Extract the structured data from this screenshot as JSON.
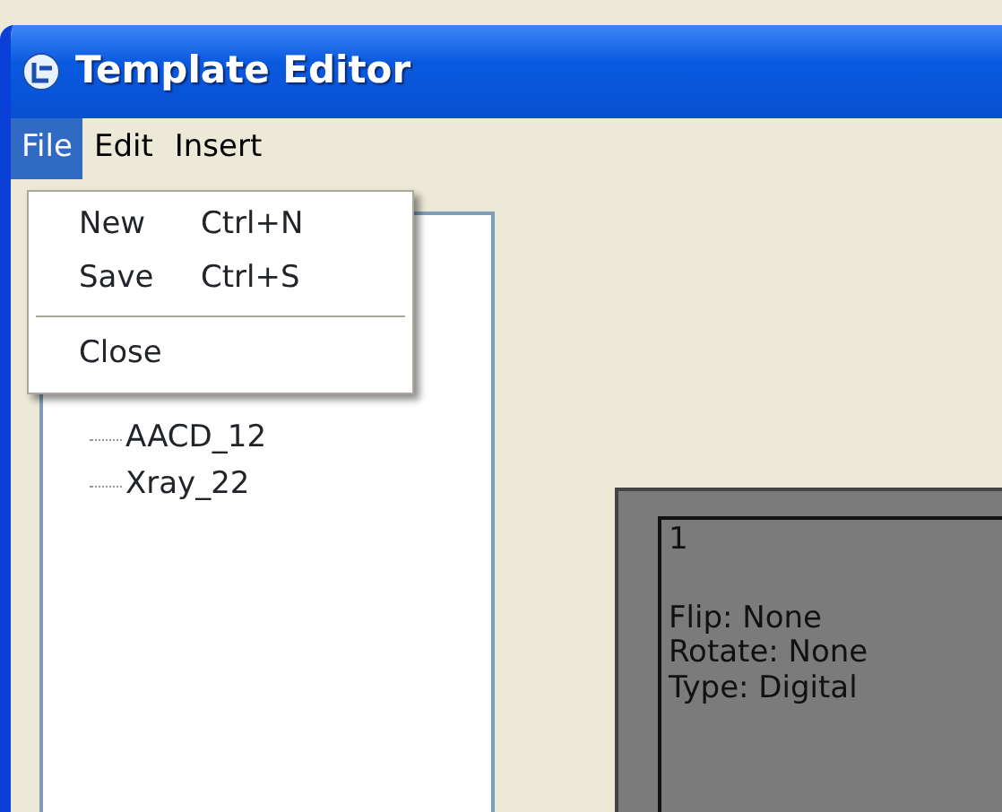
{
  "window": {
    "title": "Template Editor"
  },
  "menu_bar": [
    {
      "label": "File",
      "selected": true
    },
    {
      "label": "Edit",
      "selected": false
    },
    {
      "label": "Insert",
      "selected": false
    }
  ],
  "file_menu": [
    {
      "kind": "item",
      "label": "New",
      "shortcut": "Ctrl+N"
    },
    {
      "kind": "item",
      "label": "Save",
      "shortcut": "Ctrl+S"
    },
    {
      "kind": "separator"
    },
    {
      "kind": "item",
      "label": "Close"
    }
  ],
  "tree": [
    {
      "label": "AACD_12"
    },
    {
      "label": "Xray_22"
    }
  ],
  "preview": {
    "number": "1",
    "lines": [
      "Flip: None",
      "Rotate: None",
      "Type: Digital"
    ]
  }
}
